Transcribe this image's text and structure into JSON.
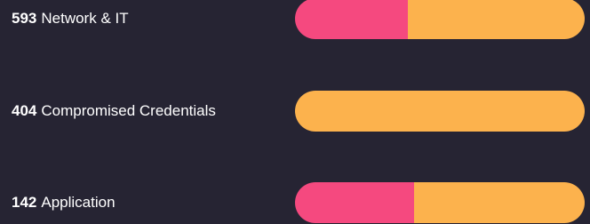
{
  "colors": {
    "background": "#262433",
    "pink": "#F5497F",
    "orange": "#FCB24D"
  },
  "rows": [
    {
      "count": "593",
      "label": "Network & IT",
      "segments": [
        {
          "color": "pink",
          "fraction": 0.39
        },
        {
          "color": "orange",
          "fraction": 0.61
        }
      ]
    },
    {
      "count": "404",
      "label": "Compromised Credentials",
      "segments": [
        {
          "color": "orange",
          "fraction": 1.0
        }
      ]
    },
    {
      "count": "142",
      "label": "Application",
      "segments": [
        {
          "color": "pink",
          "fraction": 0.41
        },
        {
          "color": "orange",
          "fraction": 0.59
        }
      ]
    }
  ]
}
